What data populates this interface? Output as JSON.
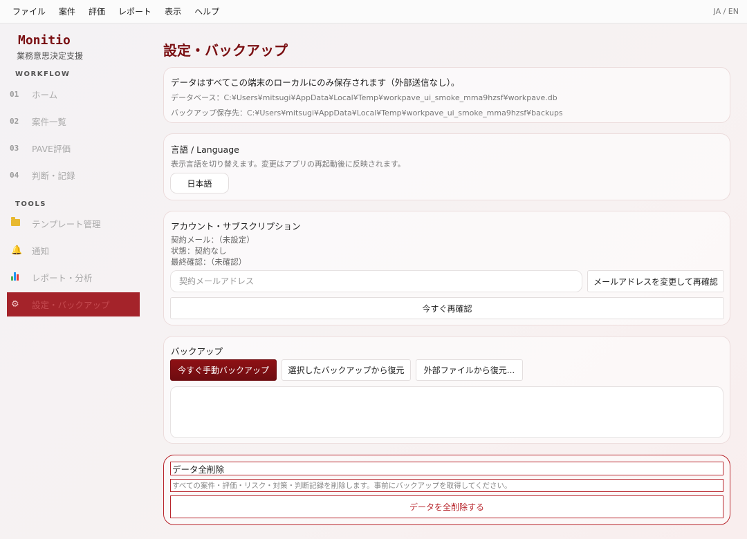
{
  "menu": {
    "items": [
      "ファイル",
      "案件",
      "評価",
      "レポート",
      "表示",
      "ヘルプ"
    ],
    "lang_switch": "JA / EN"
  },
  "sidebar": {
    "brand": "Monitio",
    "subtitle": "業務意思決定支援",
    "workflow_label": "WORKFLOW",
    "workflow": [
      {
        "num": "01",
        "label": "ホーム"
      },
      {
        "num": "02",
        "label": "案件一覧"
      },
      {
        "num": "03",
        "label": "PAVE評価"
      },
      {
        "num": "04",
        "label": "判断・記録"
      }
    ],
    "tools_label": "TOOLS",
    "tools": [
      {
        "icon": "folder-icon",
        "label": "テンプレート管理"
      },
      {
        "icon": "bell-icon",
        "label": "通知"
      },
      {
        "icon": "bar-chart-icon",
        "label": "レポート・分析"
      },
      {
        "icon": "gear-icon",
        "label": "設定・バックアップ",
        "active": true
      }
    ]
  },
  "page": {
    "title": "設定・バックアップ"
  },
  "storage": {
    "notice": "データはすべてこの端末のローカルにのみ保存されます（外部送信なし）。",
    "db_path": "データベース：C:¥Users¥mitsugi¥AppData¥Local¥Temp¥workpave_ui_smoke_mma9hzsf¥workpave.db",
    "backup_path": "バックアップ保存先：C:¥Users¥mitsugi¥AppData¥Local¥Temp¥workpave_ui_smoke_mma9hzsf¥backups"
  },
  "language": {
    "title": "言語 / Language",
    "description": "表示言語を切り替えます。変更はアプリの再起動後に反映されます。",
    "selected": "日本語"
  },
  "account": {
    "title": "アカウント・サブスクリプション",
    "email_line": "契約メール：（未設定）",
    "status_line": "状態：契約なし",
    "last_check_line": "最終確認：（未確認）",
    "email_placeholder": "契約メールアドレス",
    "change_button": "メールアドレスを変更して再確認",
    "recheck_button": "今すぐ再確認"
  },
  "backup": {
    "title": "バックアップ",
    "manual_button": "今すぐ手動バックアップ",
    "restore_selected_button": "選択したバックアップから復元",
    "restore_file_button": "外部ファイルから復元..."
  },
  "danger": {
    "title": "データ全削除",
    "description": "すべての案件・評価・リスク・対策・判断記録を削除します。事前にバックアップを取得してください。",
    "delete_button": "データを全削除する"
  },
  "colors": {
    "brand": "#7a0f12",
    "accent": "#a4232a",
    "danger": "#b8252c"
  }
}
